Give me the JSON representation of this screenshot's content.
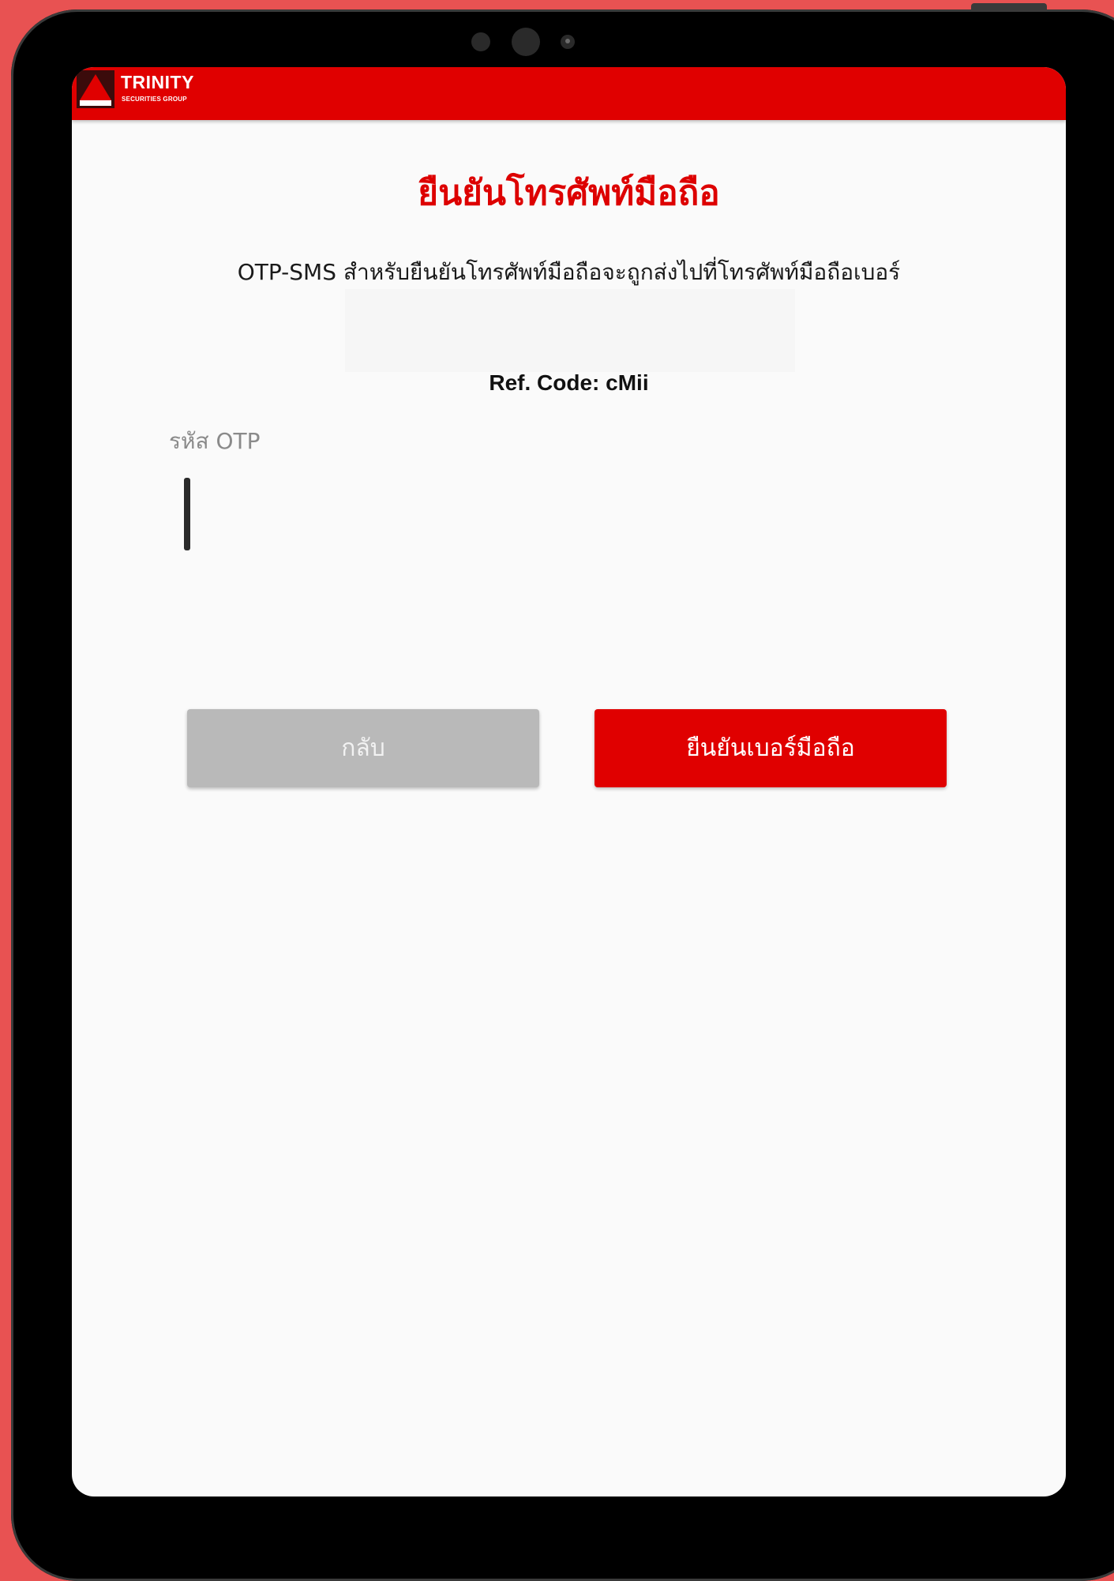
{
  "app": {
    "brand_name": "TRINITY",
    "brand_subtitle": "SECURITIES GROUP",
    "brand_color": "#e00000"
  },
  "page": {
    "title": "ยืนยันโทรศัพท์มือถือ",
    "description": "OTP-SMS สำหรับยืนยันโทรศัพท์มือถือจะถูกส่งไปที่โทรศัพท์มือถือเบอร์",
    "phone_number": "",
    "ref_code": "Ref. Code: cMii"
  },
  "otp": {
    "label": "รหัส OTP",
    "value": ""
  },
  "buttons": {
    "back_label": "กลับ",
    "confirm_label": "ยืนยันเบอร์มือถือ"
  }
}
